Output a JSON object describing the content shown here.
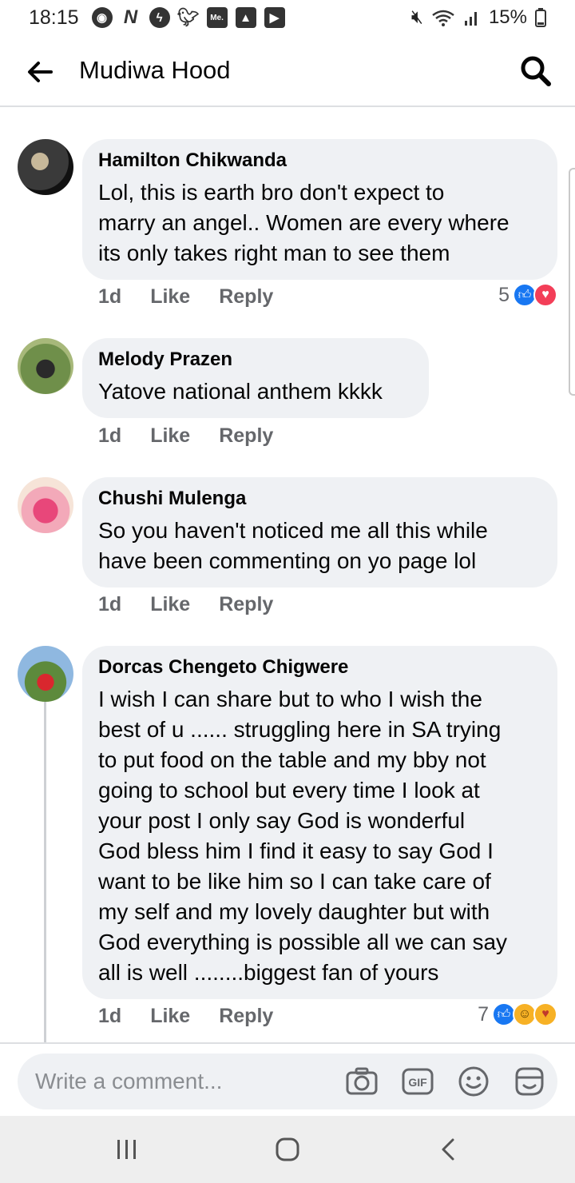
{
  "status_bar": {
    "time": "18:15",
    "notif_icons": [
      "N",
      "Me."
    ],
    "battery": "15%"
  },
  "header": {
    "title": "Mudiwa Hood"
  },
  "comments": [
    {
      "author": "Hamilton Chikwanda",
      "text": "Lol, this is earth bro don't expect to\nmarry an angel.. Women are every where\nits only takes right man to see them",
      "time": "1d",
      "like": "Like",
      "reply": "Reply",
      "reaction_count": "5"
    },
    {
      "author": "Melody Prazen",
      "text": "Yatove national anthem kkkk",
      "time": "1d",
      "like": "Like",
      "reply": "Reply"
    },
    {
      "author": "Chushi Mulenga",
      "text": "So you haven't noticed me all this while\nhave been commenting on yo page lol",
      "time": "1d",
      "like": "Like",
      "reply": "Reply"
    },
    {
      "author": "Dorcas Chengeto Chigwere",
      "text": "I wish I can share but to who I wish the\nbest of u ...... struggling here in SA trying\nto put food on the table and my bby not\ngoing to school but every time I look at\nyour post I only say God  is wonderful\nGod bless him  I find it easy to say God I\nwant to be like him so I can take care of\nmy self  and my lovely daughter but with\nGod everything is possible all we can say\nall is well ........biggest fan of yours",
      "time": "1d",
      "like": "Like",
      "reply": "Reply",
      "reaction_count": "7"
    }
  ],
  "composer": {
    "placeholder": "Write a comment..."
  },
  "colors": {
    "bubble": "#eff1f4",
    "action_text": "#65676b",
    "like_blue": "#1877f2",
    "love_red": "#f33e58"
  },
  "icons": [
    "arrow-left-icon",
    "search-icon",
    "camera-icon",
    "gif-icon",
    "emoji-icon",
    "sticker-icon",
    "recent-apps-icon",
    "home-icon",
    "back-nav-icon"
  ]
}
